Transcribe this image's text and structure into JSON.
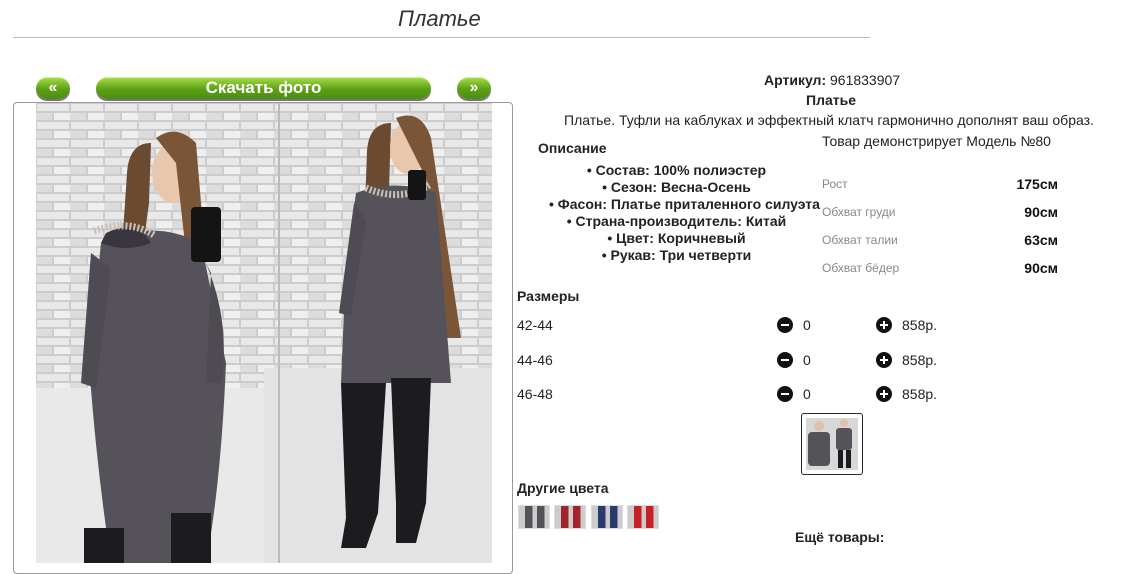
{
  "page_title": "Платье",
  "gallery": {
    "prev_label": "«",
    "download_label": "Скачать фото",
    "next_label": "»"
  },
  "product": {
    "article_label": "Артикул:",
    "article_value": "961833907",
    "name": "Платье",
    "tagline": "Платье. Туфли на каблуках и эффектный клатч гармонично дополнят ваш образ.",
    "description_heading": "Описание",
    "specs": [
      "• Состав: 100% полиэстер",
      "• Сезон: Весна-Осень",
      "• Фасон: Платье приталенного силуэта",
      "• Страна-производитель: Китай",
      "• Цвет: Коричневый",
      "• Рукав: Три четверти"
    ]
  },
  "model": {
    "caption": "Товар демонстрирует Модель №80",
    "measurements": [
      {
        "label": "Рост",
        "value": "175см"
      },
      {
        "label": "Обхват груди",
        "value": "90см"
      },
      {
        "label": "Обхват талии",
        "value": "63см"
      },
      {
        "label": "Обхват бёдер",
        "value": "90см"
      }
    ]
  },
  "sizes": {
    "heading": "Размеры",
    "rows": [
      {
        "size": "42-44",
        "qty": "0",
        "price": "858р."
      },
      {
        "size": "44-46",
        "qty": "0",
        "price": "858р."
      },
      {
        "size": "46-48",
        "qty": "0",
        "price": "858р."
      }
    ]
  },
  "other_colors_heading": "Другие цвета",
  "more_products_heading": "Ещё товары:",
  "colors": {
    "button_green": "#5da016",
    "dress": "#56525a"
  }
}
